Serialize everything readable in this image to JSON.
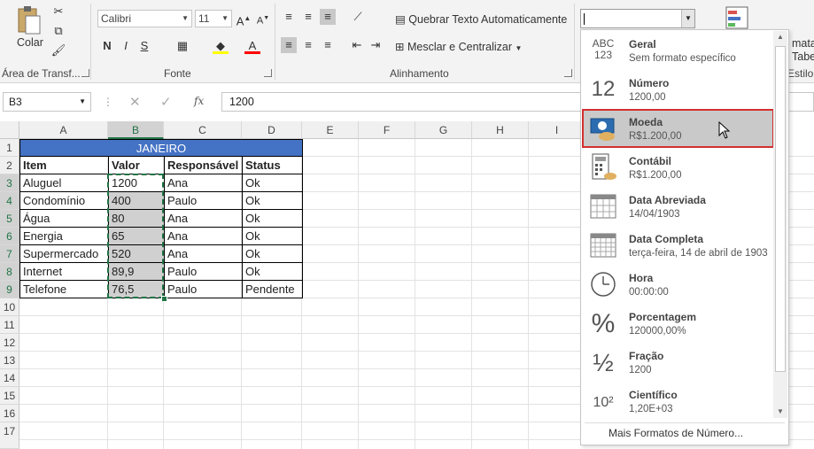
{
  "ribbon": {
    "clipboard": {
      "paste_label": "Colar",
      "group_label": "Área de Transf..."
    },
    "font": {
      "name": "Calibri",
      "size": "11",
      "group_label": "Fonte",
      "bold": "N",
      "italic": "I",
      "underline": "S",
      "grow": "A",
      "shrink": "A"
    },
    "alignment": {
      "wrap_label": "Quebrar Texto Automaticamente",
      "merge_label": "Mesclar e Centralizar",
      "group_label": "Alinhamento"
    },
    "number_format_value": "",
    "right_cut_top": "mata",
    "right_cut_mid": "Tabe",
    "right_cut_bottom": "Estilo"
  },
  "formula_bar": {
    "name_box": "B3",
    "fx_label": "fx",
    "value": "1200"
  },
  "columns": [
    "A",
    "B",
    "C",
    "D",
    "E",
    "F",
    "G",
    "H",
    "I"
  ],
  "rows": [
    "1",
    "2",
    "3",
    "4",
    "5",
    "6",
    "7",
    "8",
    "9",
    "10",
    "11",
    "12",
    "13",
    "14",
    "15",
    "16",
    "17"
  ],
  "table": {
    "title": "JANEIRO",
    "headers": [
      "Item",
      "Valor",
      "Responsável",
      "Status"
    ],
    "records": [
      [
        "Aluguel",
        "1200",
        "Ana",
        "Ok"
      ],
      [
        "Condomínio",
        "400",
        "Paulo",
        "Ok"
      ],
      [
        "Água",
        "80",
        "Ana",
        "Ok"
      ],
      [
        "Energia",
        "65",
        "Ana",
        "Ok"
      ],
      [
        "Supermercado",
        "520",
        "Ana",
        "Ok"
      ],
      [
        "Internet",
        "89,9",
        "Paulo",
        "Ok"
      ],
      [
        "Telefone",
        "76,5",
        "Paulo",
        "Pendente"
      ]
    ]
  },
  "number_format_menu": {
    "items": [
      {
        "icon_text": "ABC\n123",
        "icon": "abc-123-icon",
        "title": "Geral",
        "sub": "Sem formato específico"
      },
      {
        "icon_text": "12",
        "icon": "number-12-icon",
        "title": "Número",
        "sub": "1200,00"
      },
      {
        "icon_text": "",
        "icon": "currency-bill-icon",
        "title": "Moeda",
        "sub": "R$1.200,00"
      },
      {
        "icon_text": "",
        "icon": "accounting-calculator-icon",
        "title": "Contábil",
        "sub": " R$1.200,00"
      },
      {
        "icon_text": "",
        "icon": "calendar-short-icon",
        "title": "Data Abreviada",
        "sub": "14/04/1903"
      },
      {
        "icon_text": "",
        "icon": "calendar-long-icon",
        "title": "Data Completa",
        "sub": "terça-feira, 14 de abril de 1903"
      },
      {
        "icon_text": "",
        "icon": "clock-icon",
        "title": "Hora",
        "sub": "00:00:00"
      },
      {
        "icon_text": "%",
        "icon": "percent-icon",
        "title": "Porcentagem",
        "sub": "120000,00%"
      },
      {
        "icon_text": "½",
        "icon": "fraction-icon",
        "title": "Fração",
        "sub": "1200"
      },
      {
        "icon_text": "10²",
        "icon": "scientific-icon",
        "title": "Científico",
        "sub": "1,20E+03"
      }
    ],
    "more_label": "Mais Formatos de Número...",
    "highlighted_index": 2
  },
  "colors": {
    "table_header_fill": "#4472c4",
    "selection_green": "#217346",
    "highlight_border": "#d32f2f"
  }
}
